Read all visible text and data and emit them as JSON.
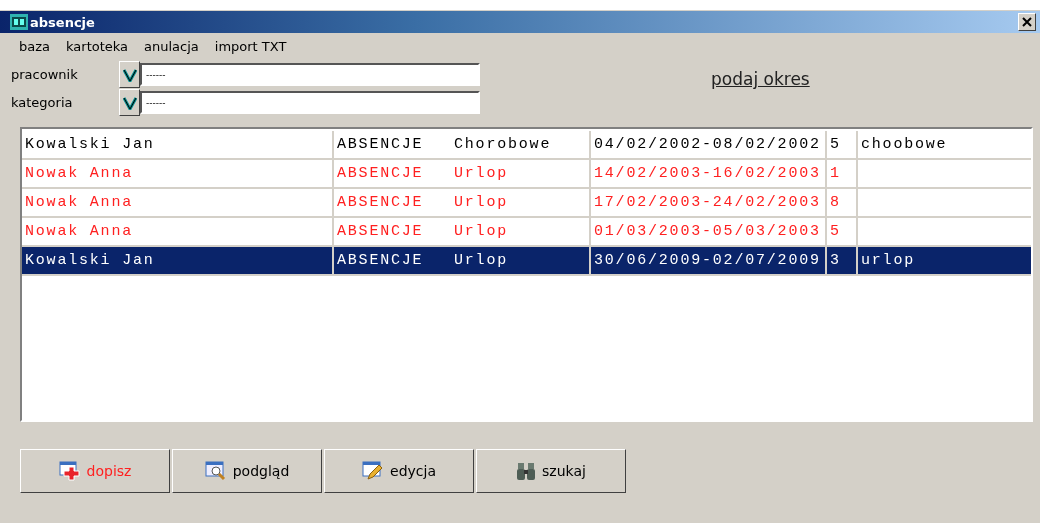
{
  "window": {
    "title": "absencje"
  },
  "menu": [
    "baza",
    "kartoteka",
    "anulacja",
    "import TXT"
  ],
  "filters": [
    {
      "label": "pracownik",
      "value": "------"
    },
    {
      "label": "kategoria",
      "value": "------"
    }
  ],
  "period_link": "podaj okres",
  "table": {
    "rows": [
      {
        "name": "Kowalski Jan",
        "category": "ABSENCJE",
        "type": "Chorobowe",
        "period": "04/02/2002-08/02/2002",
        "days": "5",
        "note": "choobowe",
        "highlighted": false,
        "selected": false
      },
      {
        "name": "Nowak Anna",
        "category": "ABSENCJE",
        "type": "Urlop",
        "period": "14/02/2003-16/02/2003",
        "days": "1",
        "highlighted": true,
        "selected": false
      },
      {
        "name": "Nowak Anna",
        "category": "ABSENCJE",
        "type": "Urlop",
        "period": "17/02/2003-24/02/2003",
        "days": "8",
        "highlighted": true,
        "selected": false
      },
      {
        "name": "Nowak Anna",
        "category": "ABSENCJE",
        "type": "Urlop",
        "period": "01/03/2003-05/03/2003",
        "days": "5",
        "highlighted": true,
        "selected": false
      },
      {
        "name": "Kowalski Jan",
        "category": "ABSENCJE",
        "type": "Urlop",
        "period": "30/06/2009-02/07/2009",
        "days": "3",
        "note": "urlop",
        "highlighted": false,
        "selected": true
      }
    ]
  },
  "buttons": [
    {
      "label": "dopisz",
      "kind": "add",
      "accent": true
    },
    {
      "label": "podgląd",
      "kind": "preview",
      "accent": false
    },
    {
      "label": "edycja",
      "kind": "edit",
      "accent": false
    },
    {
      "label": "szukaj",
      "kind": "search",
      "accent": false
    }
  ]
}
